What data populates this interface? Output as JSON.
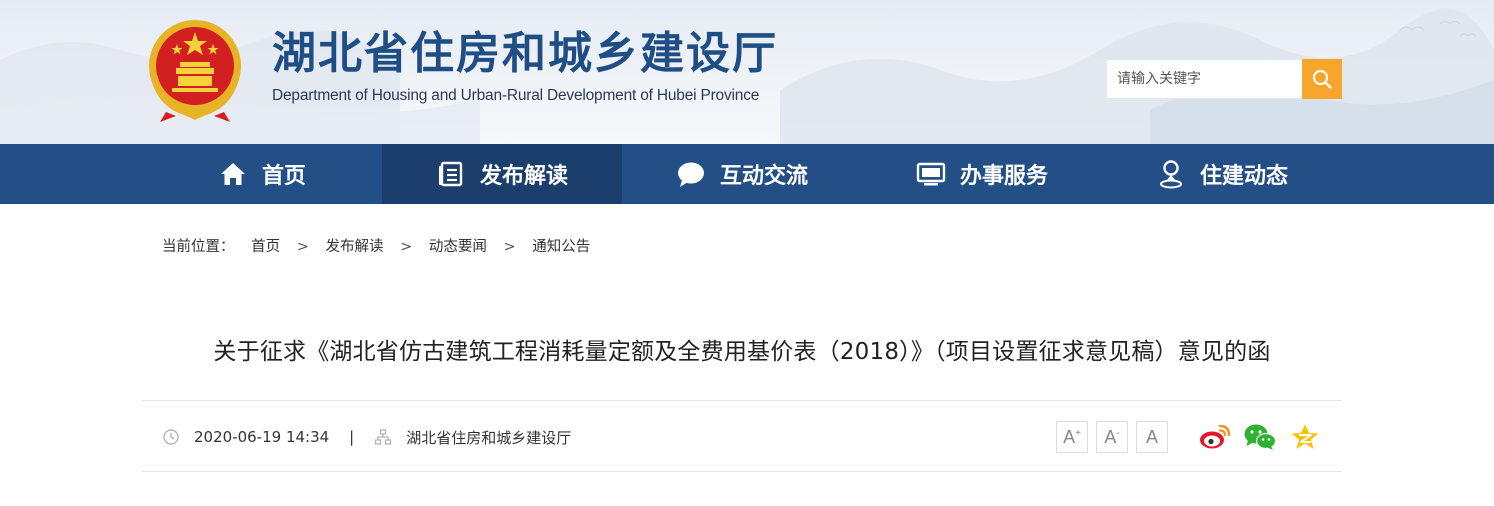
{
  "header": {
    "site_title": "湖北省住房和城乡建设厅",
    "site_subtitle": "Department of Housing and Urban-Rural Development of Hubei Province",
    "emblem_icon": "national-emblem-icon",
    "search_placeholder": "请输入关键字",
    "search_icon": "search-icon",
    "accent_color": "#f7a52b"
  },
  "nav": {
    "background": "#234f86",
    "items": [
      {
        "label": "首页",
        "icon": "home-icon"
      },
      {
        "label": "发布解读",
        "icon": "document-list-icon",
        "active": true
      },
      {
        "label": "互动交流",
        "icon": "chat-bubble-icon"
      },
      {
        "label": "办事服务",
        "icon": "monitor-icon"
      },
      {
        "label": "住建动态",
        "icon": "person-pin-icon"
      }
    ]
  },
  "breadcrumb": {
    "label": "当前位置：",
    "items": [
      "首页",
      "发布解读",
      "动态要闻",
      "通知公告"
    ],
    "separator": ">"
  },
  "article": {
    "title": "关于征求《湖北省仿古建筑工程消耗量定额及全费用基价表（2018）》（项目设置征求意见稿）意见的函",
    "datetime": "2020-06-19 14:34",
    "divider": "|",
    "source": "湖北省住房和城乡建设厅"
  },
  "font_controls": {
    "increase": "A",
    "increase_mark": "+",
    "decrease": "A",
    "decrease_mark": "-",
    "reset": "A"
  },
  "share": [
    {
      "icon": "weibo-icon",
      "color": "#e6162d"
    },
    {
      "icon": "wechat-icon",
      "color": "#2fb233"
    },
    {
      "icon": "qzone-star-icon",
      "color": "#f5c400"
    }
  ]
}
